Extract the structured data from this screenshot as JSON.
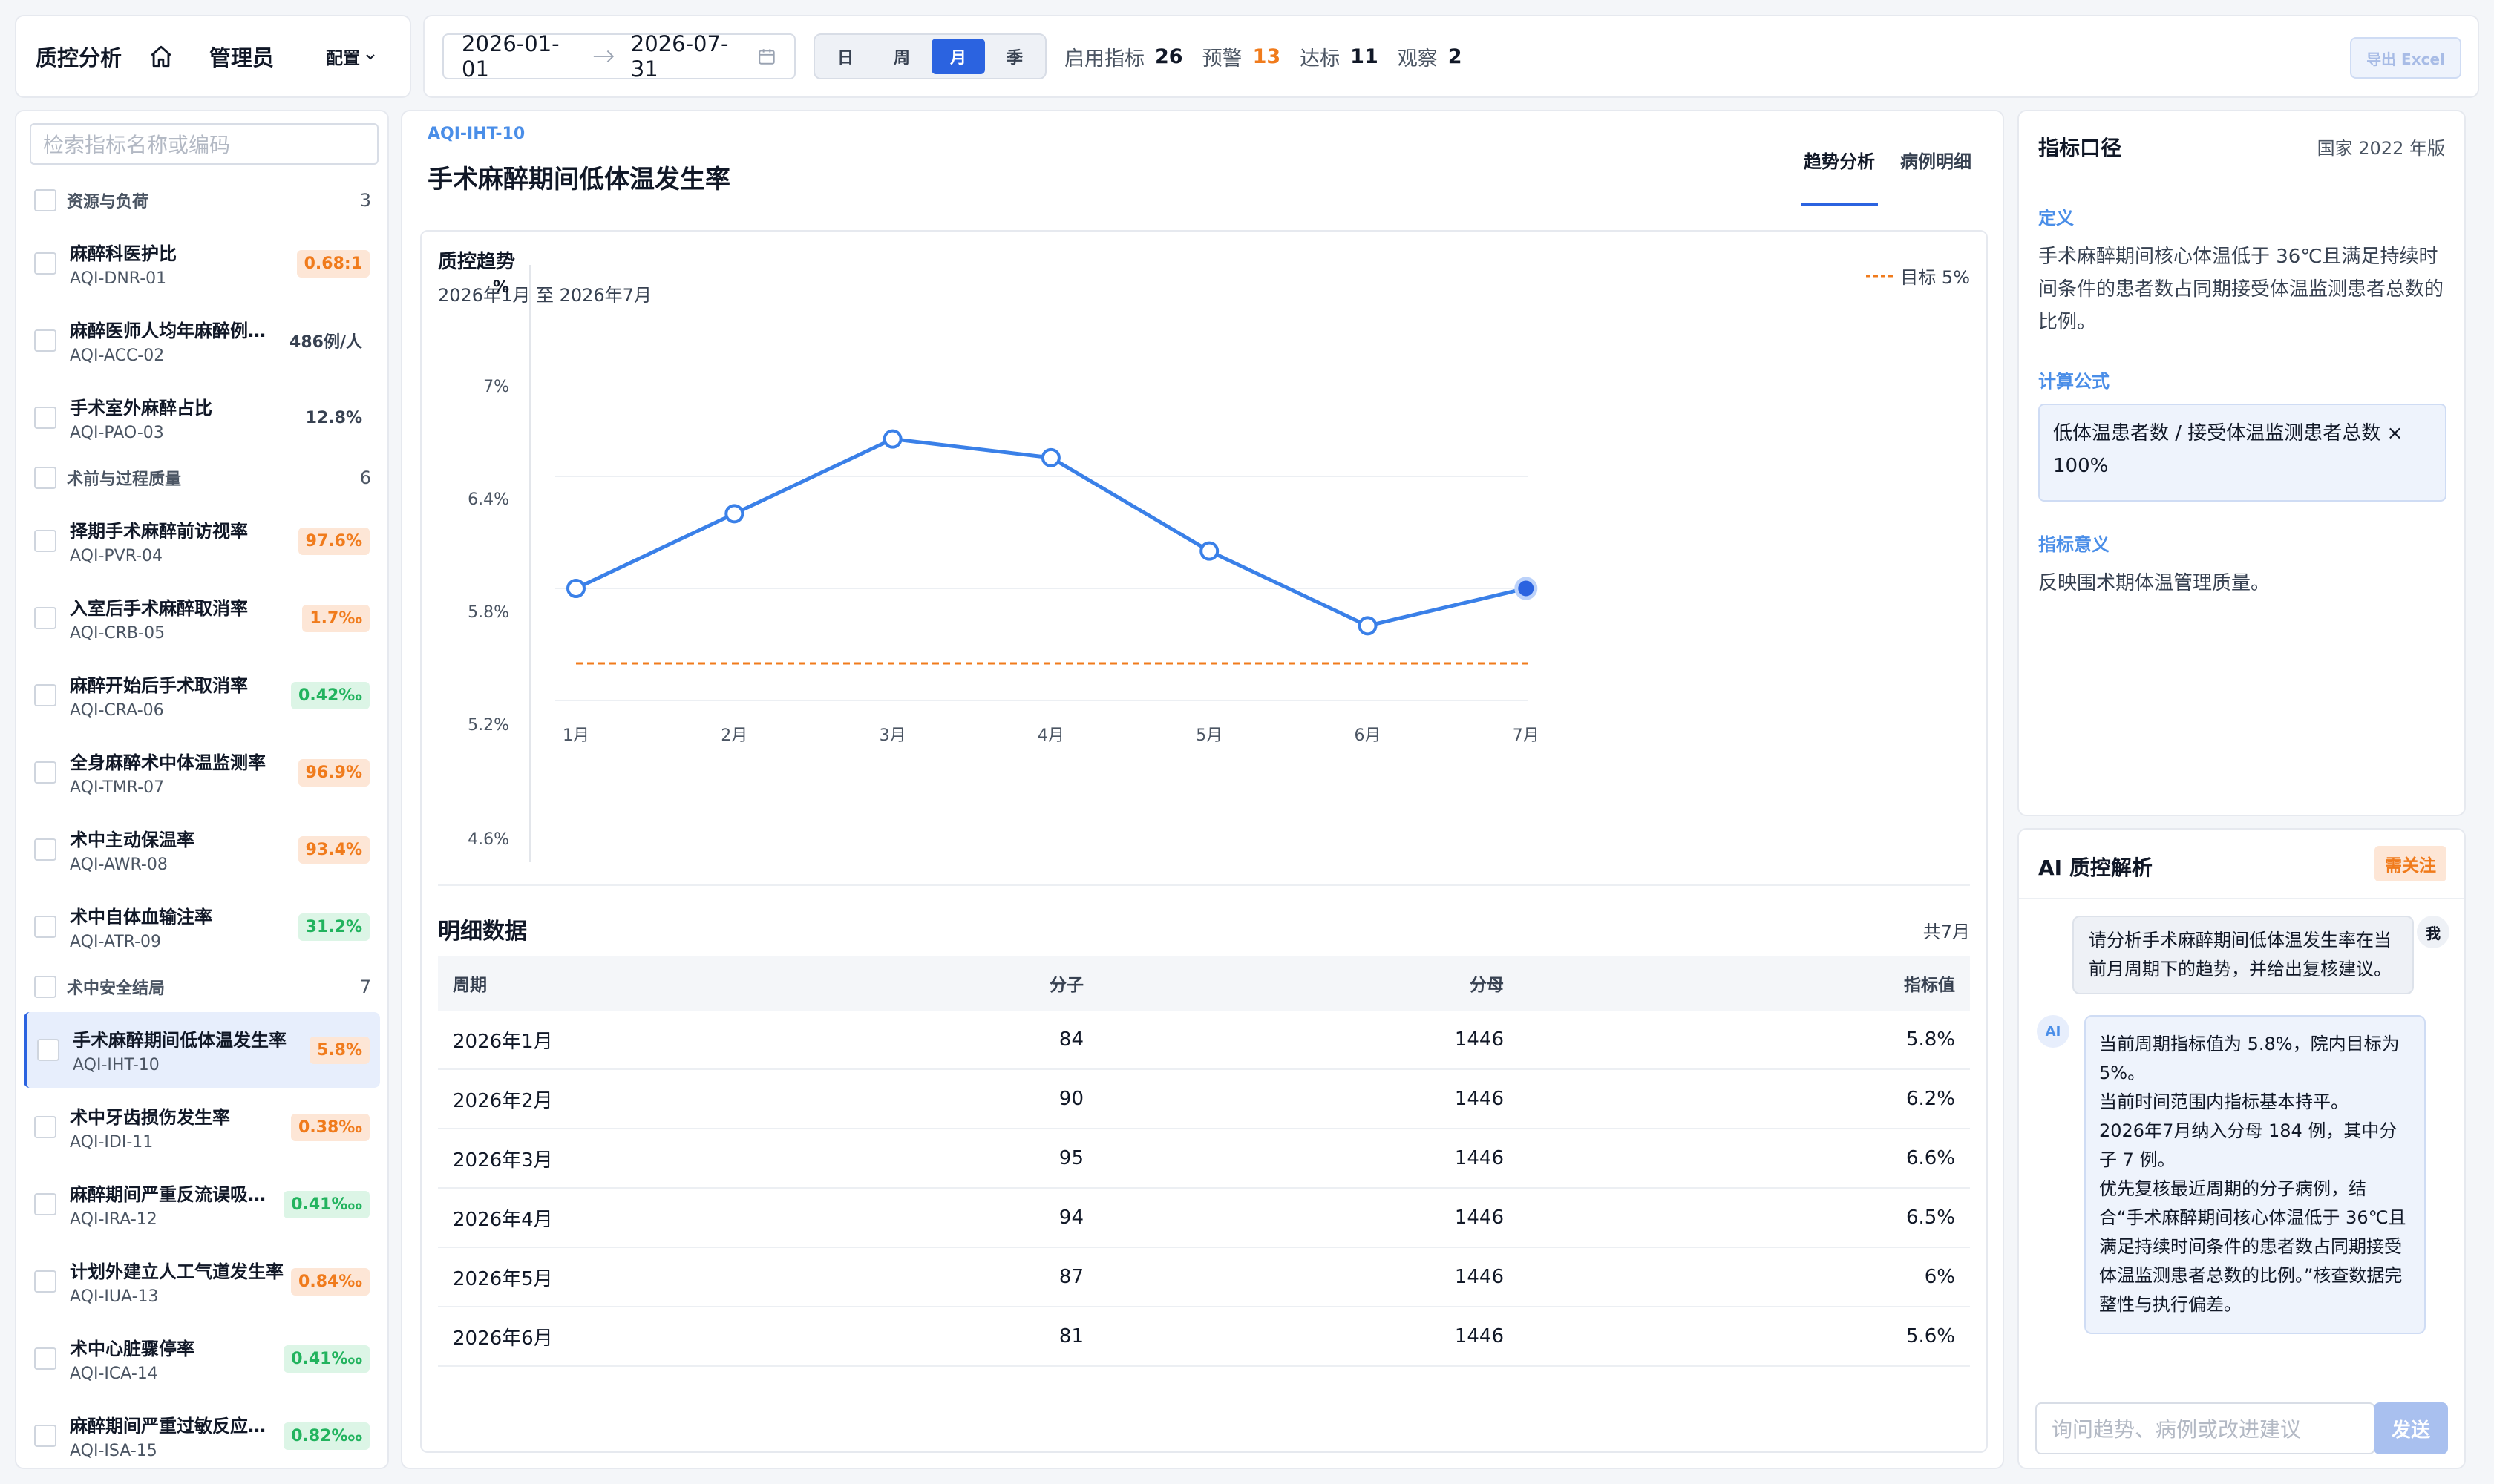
{
  "header": {
    "app_title": "质控分析",
    "role": "管理员",
    "config_label": "配置",
    "date_start": "2026-01-01",
    "date_end": "2026-07-31",
    "granularity": [
      "日",
      "周",
      "月",
      "季"
    ],
    "granularity_selected": "月",
    "stats": {
      "enabled_label": "启用指标",
      "enabled": "26",
      "warn_label": "预警",
      "warn": "13",
      "ok_label": "达标",
      "ok": "11",
      "watch_label": "观察",
      "watch": "2"
    },
    "export_label": "导出 Excel"
  },
  "sidebar": {
    "search_placeholder": "检索指标名称或编码",
    "groups": [
      {
        "label": "资源与负荷",
        "count": "3"
      },
      {
        "label": "术前与过程质量",
        "count": "6"
      },
      {
        "label": "术中安全结局",
        "count": "7"
      }
    ],
    "items": [
      {
        "name": "麻醉科医护比",
        "code": "AQI-DNR-01",
        "value": "0.68:1",
        "tone": "or"
      },
      {
        "name": "麻醉医师人均年麻醉例次数",
        "code": "AQI-ACC-02",
        "value": "486例/人",
        "tone": "pl"
      },
      {
        "name": "手术室外麻醉占比",
        "code": "AQI-PAO-03",
        "value": "12.8%",
        "tone": "pl"
      },
      {
        "name": "择期手术麻醉前访视率",
        "code": "AQI-PVR-04",
        "value": "97.6%",
        "tone": "or"
      },
      {
        "name": "入室后手术麻醉取消率",
        "code": "AQI-CRB-05",
        "value": "1.7‰",
        "tone": "or"
      },
      {
        "name": "麻醉开始后手术取消率",
        "code": "AQI-CRA-06",
        "value": "0.42‰",
        "tone": "gr"
      },
      {
        "name": "全身麻醉术中体温监测率",
        "code": "AQI-TMR-07",
        "value": "96.9%",
        "tone": "or"
      },
      {
        "name": "术中主动保温率",
        "code": "AQI-AWR-08",
        "value": "93.4%",
        "tone": "or"
      },
      {
        "name": "术中自体血输注率",
        "code": "AQI-ATR-09",
        "value": "31.2%",
        "tone": "gr"
      },
      {
        "name": "手术麻醉期间低体温发生率",
        "code": "AQI-IHT-10",
        "value": "5.8%",
        "tone": "or"
      },
      {
        "name": "术中牙齿损伤发生率",
        "code": "AQI-IDI-11",
        "value": "0.38‰",
        "tone": "or"
      },
      {
        "name": "麻醉期间严重反流误吸发生率",
        "code": "AQI-IRA-12",
        "value": "0.41‱",
        "tone": "gr"
      },
      {
        "name": "计划外建立人工气道发生率",
        "code": "AQI-IUA-13",
        "value": "0.84‰",
        "tone": "or"
      },
      {
        "name": "术中心脏骤停率",
        "code": "AQI-ICA-14",
        "value": "0.41‱",
        "tone": "gr"
      },
      {
        "name": "麻醉期间严重过敏反应发生率",
        "code": "AQI-ISA-15",
        "value": "0.82‱",
        "tone": "gr"
      }
    ],
    "selected_index": 9
  },
  "main": {
    "code": "AQI-IHT-10",
    "title": "手术麻醉期间低体温发生率",
    "tabs": [
      "趋势分析",
      "病例明细"
    ],
    "chart_title": "质控趋势",
    "chart_subtitle": "2026年1月 至 2026年7月",
    "target_label": "目标 5%",
    "detail_title": "明细数据",
    "detail_count": "共7月",
    "table_headers": [
      "周期",
      "分子",
      "分母",
      "指标值"
    ],
    "table_rows": [
      [
        "2026年1月",
        "84",
        "1446",
        "5.8%"
      ],
      [
        "2026年2月",
        "90",
        "1446",
        "6.2%"
      ],
      [
        "2026年3月",
        "95",
        "1446",
        "6.6%"
      ],
      [
        "2026年4月",
        "94",
        "1446",
        "6.5%"
      ],
      [
        "2026年5月",
        "87",
        "1446",
        "6%"
      ],
      [
        "2026年6月",
        "81",
        "1446",
        "5.6%"
      ]
    ]
  },
  "chart_data": {
    "type": "line",
    "ylabel": "%",
    "x": [
      "1月",
      "2月",
      "3月",
      "4月",
      "5月",
      "6月",
      "7月"
    ],
    "y_ticks": [
      "7%",
      "6.4%",
      "5.8%",
      "5.2%",
      "4.6%"
    ],
    "series": [
      {
        "values": [
          5.8,
          6.2,
          6.6,
          6.5,
          6.0,
          5.6,
          5.8
        ],
        "color": "#3a80e8"
      }
    ],
    "target": 5,
    "target_color": "#f07b1c",
    "grid": true
  },
  "definition": {
    "title": "指标口径",
    "version": "国家 2022 年版",
    "def_label": "定义",
    "def_text": "手术麻醉期间核心体温低于 36℃且满足持续时间条件的患者数占同期接受体温监测患者总数的比例。",
    "formula_label": "计算公式",
    "formula_text": "低体温患者数 / 接受体温监测患者总数 × 100%",
    "meaning_label": "指标意义",
    "meaning_text": "反映围术期体温管理质量。"
  },
  "ai": {
    "title": "AI 质控解析",
    "tag": "需关注",
    "user_avatar": "我",
    "ai_avatar": "AI",
    "user_message": "请分析手术麻醉期间低体温发生率在当前月周期下的趋势，并给出复核建议。",
    "ai_lines": [
      "当前周期指标值为 5.8%，院内目标为 5%。",
      "当前时间范围内指标基本持平。",
      "2026年7月纳入分母 184 例，其中分子 7 例。",
      "优先复核最近周期的分子病例，结合“手术麻醉期间核心体温低于 36℃且满足持续时间条件的患者数占同期接受体温监测患者总数的比例。”核查数据完整性与执行偏差。"
    ],
    "input_placeholder": "询问趋势、病例或改进建议",
    "send_label": "发送"
  }
}
